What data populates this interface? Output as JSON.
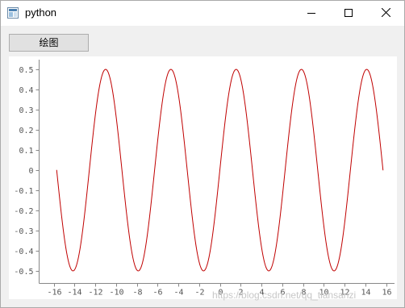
{
  "window": {
    "title": "python",
    "icon": "python-window-icon",
    "controls": [
      "minimize-icon",
      "maximize-icon",
      "close-icon"
    ]
  },
  "toolbar": {
    "draw_button_label": "绘图"
  },
  "chart_data": {
    "type": "line",
    "title": "",
    "xlabel": "",
    "ylabel": "",
    "xlim": [
      -16,
      16
    ],
    "ylim": [
      -0.5,
      0.5
    ],
    "xticks": [
      "-16",
      "-14",
      "-12",
      "-10",
      "-8",
      "-6",
      "-4",
      "-2",
      "0",
      "2",
      "4",
      "6",
      "8",
      "10",
      "12",
      "14",
      "16"
    ],
    "yticks": [
      "0.5",
      "0.4",
      "0.3",
      "0.2",
      "0.1",
      "0",
      "-0.1",
      "-0.2",
      "-0.3",
      "-0.4",
      "-0.5"
    ],
    "grid": false,
    "series": [
      {
        "color": "#c00000",
        "function": "0.5*sin(x)",
        "x_range": [
          -15.71,
          15.71
        ],
        "x": [
          -15.71,
          -14.14,
          -12.57,
          -11.0,
          -9.42,
          -7.85,
          -6.28,
          -4.71,
          -3.14,
          -1.57,
          0,
          1.57,
          3.14,
          4.71,
          6.28,
          7.85,
          9.42,
          11.0,
          12.57,
          14.14,
          15.71
        ],
        "y": [
          0,
          -0.5,
          0,
          0.5,
          0,
          -0.5,
          0,
          0.5,
          0,
          -0.5,
          0,
          0.5,
          0,
          -0.5,
          0,
          0.5,
          0,
          -0.5,
          0,
          0.5,
          0
        ]
      }
    ]
  },
  "watermark": "https://blog.csdn.net/qq_tiansanzi"
}
